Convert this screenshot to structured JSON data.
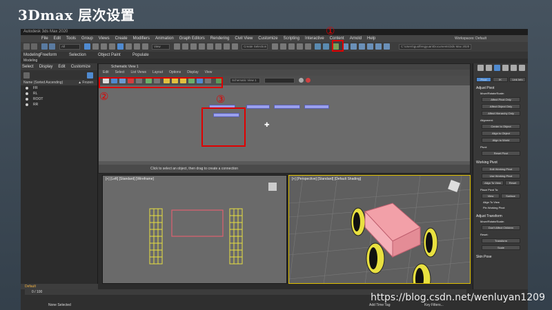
{
  "slide": {
    "title": "3Dmax 层次设置"
  },
  "app": {
    "window_title": "Autodesk 3ds Max 2020",
    "menus": [
      "File",
      "Edit",
      "Tools",
      "Group",
      "Views",
      "Create",
      "Modifiers",
      "Animation",
      "Graph Editors",
      "Rendering",
      "Civil View",
      "Customize",
      "Scripting",
      "Interactive",
      "Content",
      "Arnold",
      "Help"
    ],
    "workspaces_label": "Workspaces: Default",
    "selection_set": "Create Selection Set",
    "view_mode": "View",
    "project_path": "C:\\Users\\guolfengyuan\\Documents\\3ds Max 2020"
  },
  "ribbon": {
    "tabs": [
      "Modeling",
      "Freeform",
      "Selection",
      "Object Paint",
      "Populate"
    ],
    "subtab": "Modeling"
  },
  "scene_explorer": {
    "tabs": [
      "Select",
      "Display",
      "Edit",
      "Customize"
    ],
    "header": {
      "name": "Name (Sorted Ascending)",
      "frozen": "▲ Frozen"
    },
    "items": [
      {
        "label": "FR"
      },
      {
        "label": "RL"
      },
      {
        "label": "ROOT"
      },
      {
        "label": "RR"
      }
    ],
    "layer": "Default"
  },
  "schematic": {
    "title": "Schematic View 1",
    "menus": [
      "Edit",
      "Select",
      "List Views",
      "Layout",
      "Options",
      "Display",
      "View"
    ],
    "view_name": "Schematic View 1",
    "status": "Click to select an object, then drag to create a connection"
  },
  "viewports": {
    "left_label": "[+] [Left] [Standard] [Wireframe]",
    "persp_label": "[+] [Perspective] [Standard] [Default Shading]"
  },
  "command_panel": {
    "tabs": [
      "Pivot",
      "IK",
      "Link Info"
    ],
    "adjust_pivot": "Adjust Pivot",
    "move_rotate_scale": "Move/Rotate/Scale:",
    "affect_pivot_only": "Affect Pivot Only",
    "affect_object_only": "Affect Object Only",
    "affect_hierarchy_only": "Affect Hierarchy Only",
    "alignment": "Alignment:",
    "center_to_object": "Center to Object",
    "align_to_object": "Align to Object",
    "align_to_world": "Align to World",
    "pivot_section": "Pivot:",
    "reset_pivot": "Reset Pivot",
    "working_pivot": "Working Pivot",
    "edit_working_pivot": "Edit Working Pivot",
    "use_working_pivot": "Use Working Pivot",
    "align_to_view": "Align To View",
    "reset": "Reset",
    "place_pivot_to": "Place Pivot To:",
    "view": "View",
    "surface": "Surface",
    "align_to_view_check": "Align To View",
    "pin_working_pivot": "Pin Working Pivot",
    "adjust_transform": "Adjust Transform",
    "dont_affect_children": "Don't Affect Children",
    "reset_section": "Reset:",
    "transform": "Transform",
    "scale": "Scale",
    "skin_pose": "Skin Pose"
  },
  "bottom": {
    "frame": "0 / 100",
    "status_selected": "None Selected",
    "add_time_tag": "Add Time Tag",
    "key_filters": "Key Filters..."
  },
  "annotations": [
    "①",
    "②",
    "③"
  ],
  "watermark": "https://blog.csdn.net/wenluyan1209",
  "colors": {
    "annotation_red": "#e00000",
    "node_blue": "#9aa0ee",
    "car_body": "#f2a0a8",
    "wheel_yellow": "#e8e040"
  }
}
